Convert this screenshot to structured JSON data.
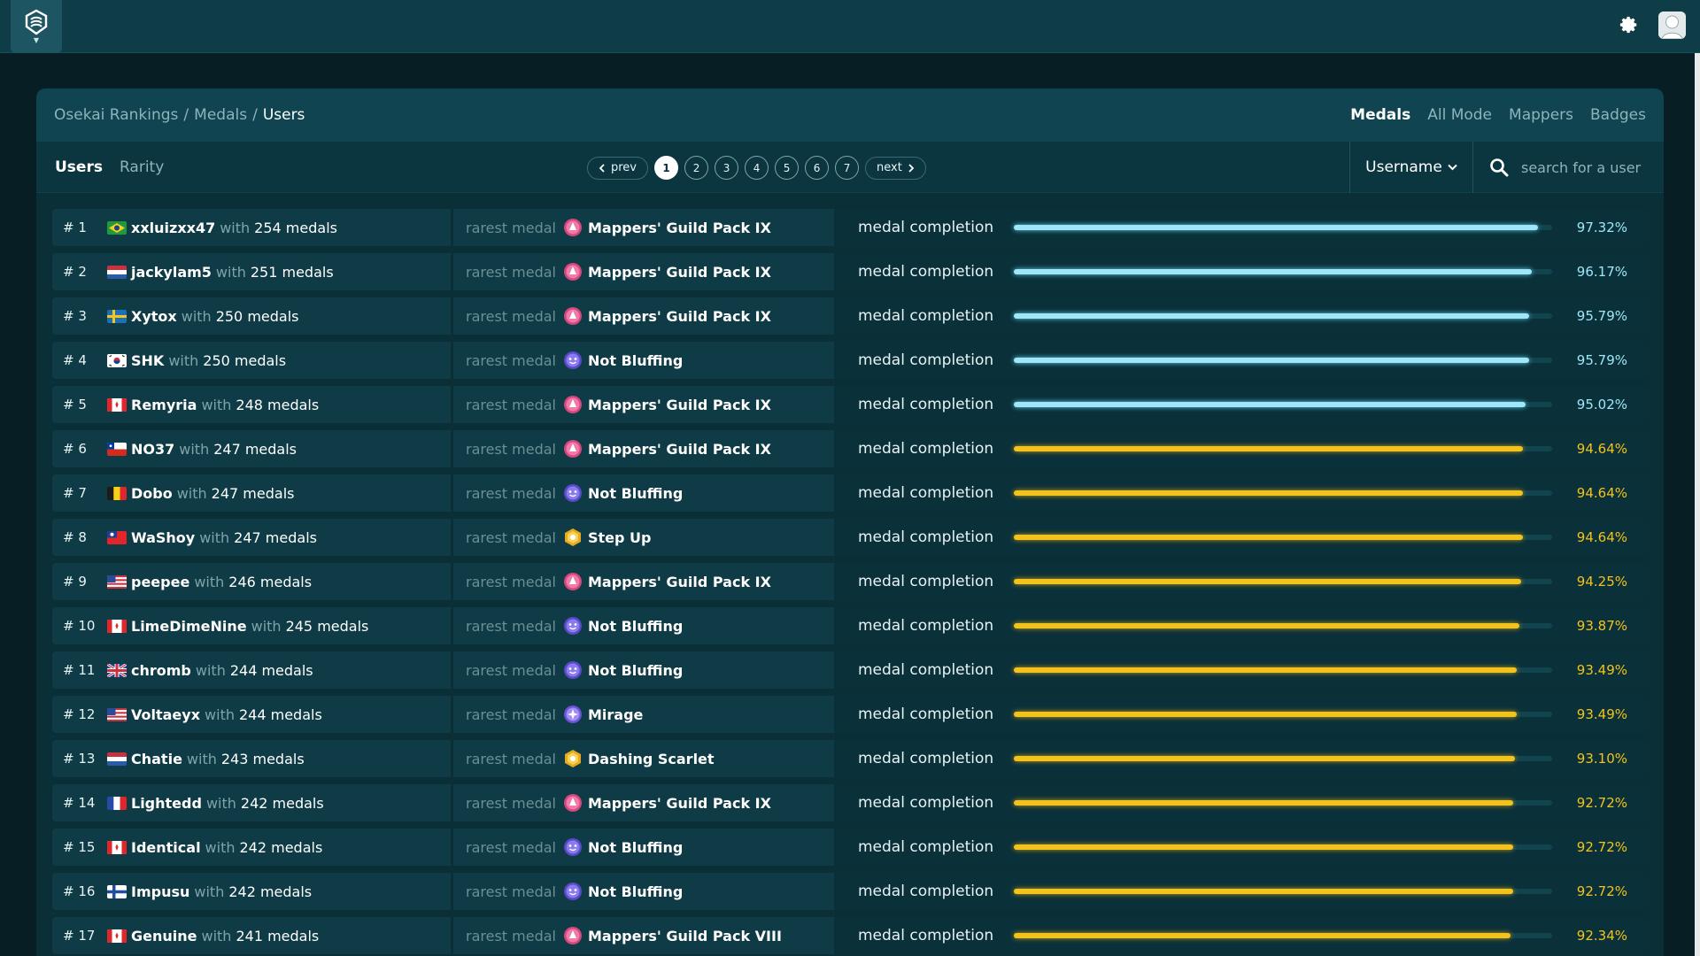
{
  "header": {
    "breadcrumb": [
      "Osekai Rankings",
      "Medals",
      "Users"
    ],
    "modes": [
      "Medals",
      "All Mode",
      "Mappers",
      "Badges"
    ],
    "active_mode": "Medals"
  },
  "toolbar": {
    "subtabs": [
      "Users",
      "Rarity"
    ],
    "prev_label": "prev",
    "next_label": "next",
    "pages": [
      "1",
      "2",
      "3",
      "4",
      "5",
      "6",
      "7"
    ],
    "current_page": "1",
    "sort_label": "Username",
    "search_placeholder": "search for a user"
  },
  "labels": {
    "with": "with",
    "medals_suffix": "medals",
    "rarest_medal": "rarest medal",
    "medal_completion": "medal completion"
  },
  "colors": {
    "high": "#9fe7f8",
    "mid": "#f2c31e",
    "accent": "#0f4450"
  },
  "rows": [
    {
      "rank": "# 1",
      "flag": "br",
      "user": "xxluizxx47",
      "medals": "254 medals",
      "rarest": "Mappers' Guild Pack IX",
      "medal_icon": "pink",
      "completion": 97.32,
      "pct": "97.32%",
      "tier": "blue"
    },
    {
      "rank": "# 2",
      "flag": "nl",
      "user": "jackylam5",
      "medals": "251 medals",
      "rarest": "Mappers' Guild Pack IX",
      "medal_icon": "pink",
      "completion": 96.17,
      "pct": "96.17%",
      "tier": "blue"
    },
    {
      "rank": "# 3",
      "flag": "se",
      "user": "Xytox",
      "medals": "250 medals",
      "rarest": "Mappers' Guild Pack IX",
      "medal_icon": "pink",
      "completion": 95.79,
      "pct": "95.79%",
      "tier": "blue"
    },
    {
      "rank": "# 4",
      "flag": "kr",
      "user": "SHK",
      "medals": "250 medals",
      "rarest": "Not Bluffing",
      "medal_icon": "purple",
      "completion": 95.79,
      "pct": "95.79%",
      "tier": "blue"
    },
    {
      "rank": "# 5",
      "flag": "ca",
      "user": "Remyria",
      "medals": "248 medals",
      "rarest": "Mappers' Guild Pack IX",
      "medal_icon": "pink",
      "completion": 95.02,
      "pct": "95.02%",
      "tier": "blue"
    },
    {
      "rank": "# 6",
      "flag": "cl",
      "user": "NO37",
      "medals": "247 medals",
      "rarest": "Mappers' Guild Pack IX",
      "medal_icon": "pink",
      "completion": 94.64,
      "pct": "94.64%",
      "tier": "gold"
    },
    {
      "rank": "# 7",
      "flag": "be",
      "user": "Dobo",
      "medals": "247 medals",
      "rarest": "Not Bluffing",
      "medal_icon": "purple",
      "completion": 94.64,
      "pct": "94.64%",
      "tier": "gold"
    },
    {
      "rank": "# 8",
      "flag": "tw",
      "user": "WaShoy",
      "medals": "247 medals",
      "rarest": "Step Up",
      "medal_icon": "gold",
      "completion": 94.64,
      "pct": "94.64%",
      "tier": "gold"
    },
    {
      "rank": "# 9",
      "flag": "us",
      "user": "peepee",
      "medals": "246 medals",
      "rarest": "Mappers' Guild Pack IX",
      "medal_icon": "pink",
      "completion": 94.25,
      "pct": "94.25%",
      "tier": "gold"
    },
    {
      "rank": "# 10",
      "flag": "ca",
      "user": "LimeDimeNine",
      "medals": "245 medals",
      "rarest": "Not Bluffing",
      "medal_icon": "purple",
      "completion": 93.87,
      "pct": "93.87%",
      "tier": "gold"
    },
    {
      "rank": "# 11",
      "flag": "gb",
      "user": "chromb",
      "medals": "244 medals",
      "rarest": "Not Bluffing",
      "medal_icon": "purple",
      "completion": 93.49,
      "pct": "93.49%",
      "tier": "gold"
    },
    {
      "rank": "# 12",
      "flag": "us",
      "user": "Voltaeyx",
      "medals": "244 medals",
      "rarest": "Mirage",
      "medal_icon": "violet",
      "completion": 93.49,
      "pct": "93.49%",
      "tier": "gold"
    },
    {
      "rank": "# 13",
      "flag": "nl",
      "user": "Chatie",
      "medals": "243 medals",
      "rarest": "Dashing Scarlet",
      "medal_icon": "gold",
      "completion": 93.1,
      "pct": "93.10%",
      "tier": "gold"
    },
    {
      "rank": "# 14",
      "flag": "fr",
      "user": "Lightedd",
      "medals": "242 medals",
      "rarest": "Mappers' Guild Pack IX",
      "medal_icon": "pink",
      "completion": 92.72,
      "pct": "92.72%",
      "tier": "gold"
    },
    {
      "rank": "# 15",
      "flag": "ca",
      "user": "Identical",
      "medals": "242 medals",
      "rarest": "Not Bluffing",
      "medal_icon": "purple",
      "completion": 92.72,
      "pct": "92.72%",
      "tier": "gold"
    },
    {
      "rank": "# 16",
      "flag": "fi",
      "user": "Impusu",
      "medals": "242 medals",
      "rarest": "Not Bluffing",
      "medal_icon": "purple",
      "completion": 92.72,
      "pct": "92.72%",
      "tier": "gold"
    },
    {
      "rank": "# 17",
      "flag": "ca",
      "user": "Genuine",
      "medals": "241 medals",
      "rarest": "Mappers' Guild Pack VIII",
      "medal_icon": "pink",
      "completion": 92.34,
      "pct": "92.34%",
      "tier": "gold"
    }
  ]
}
